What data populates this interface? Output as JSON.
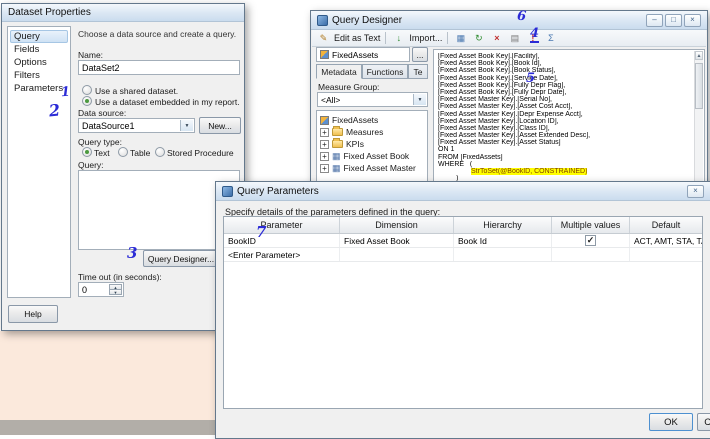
{
  "colors": {
    "annotation_ink": "#2b2bd6",
    "highlight": "#ffff00",
    "titlebar_accent": "#cadcee",
    "surface_peach": "#fbe9dc"
  },
  "annotations": {
    "n1": "1",
    "n2": "2",
    "n3": "3",
    "n4": "4",
    "n5": "5",
    "n6": "6",
    "n7": "7"
  },
  "icons": {
    "close": "×",
    "minimize": "–",
    "maximize": "□",
    "dropdown": "▼",
    "spin_up": "▲",
    "spin_down": "▼",
    "pencil": "✎",
    "import_arrow": "↓",
    "design_grid": "▦",
    "refresh": "↻",
    "delete": "×",
    "empty_cells": "▤",
    "exclaim": "!",
    "sigma": "Σ",
    "plus": "+",
    "dimension": "▦",
    "scroll_up": "▲"
  },
  "dataset_properties": {
    "title": "Dataset Properties",
    "nav": [
      "Query",
      "Fields",
      "Options",
      "Filters",
      "Parameters"
    ],
    "heading": "Choose a data source and create a query.",
    "name_label": "Name:",
    "name_value": "DataSet2",
    "shared_dataset_option": "Use a shared dataset.",
    "embedded_dataset_option": "Use a dataset embedded in my report.",
    "data_source_label": "Data source:",
    "data_source_value": "DataSource1",
    "new_button": "New...",
    "query_type_label": "Query type:",
    "query_type_options": [
      "Text",
      "Table",
      "Stored Procedure"
    ],
    "query_label": "Query:",
    "query_designer_button": "Query Designer...",
    "timeout_label": "Time out (in seconds):",
    "timeout_value": "0",
    "help_button": "Help"
  },
  "query_designer": {
    "title": "Query Designer",
    "toolbar": {
      "edit_as_text": "Edit as Text",
      "import": "Import..."
    },
    "cube_name": "FixedAssets",
    "cube_browse_button": "...",
    "tabs": [
      "Metadata",
      "Functions",
      "Te"
    ],
    "measure_group_label": "Measure Group:",
    "measure_group_value": "<All>",
    "tree": [
      "FixedAssets",
      "Measures",
      "KPIs",
      "Fixed Asset Book",
      "Fixed Asset Master"
    ],
    "query_lines": [
      "[Fixed Asset Book Key].[Facility],",
      "[Fixed Asset Book Key].[Book Id],",
      "[Fixed Asset Book Key].[Book Status],",
      "[Fixed Asset Book Key].[Service Date],",
      "[Fixed Asset Book Key].[Fully Depr Flag],",
      "[Fixed Asset Book Key].[Fully Depr Date],",
      "[Fixed Asset Master Key].[Serial No],",
      "[Fixed Asset Master Key].[Asset Cost Acct],",
      "[Fixed Asset Master Key].[Depr Expense Acct],",
      "[Fixed Asset Master Key].[Location ID],",
      "[Fixed Asset Master Key].[Class ID],",
      "[Fixed Asset Master Key].[Asset Extended Desc],",
      "[Fixed Asset Master Key].[Asset Status]",
      "ON 1",
      "FROM [FixedAssets]",
      "WHERE   ("
    ],
    "highlighted_text": "StrToSet(@BookID, CONSTRAINED)",
    "closing_paren": ")"
  },
  "query_parameters": {
    "title": "Query Parameters",
    "instruction": "Specify details of the parameters defined in the query:",
    "columns": [
      "Parameter",
      "Dimension",
      "Hierarchy",
      "Multiple values",
      "Default"
    ],
    "rows": [
      {
        "parameter": "BookID",
        "dimension": "Fixed Asset Book",
        "hierarchy": "Book Id",
        "multiple_mark": "✓",
        "default": "ACT, AMT, STA, TAX"
      },
      {
        "parameter": "<Enter Parameter>",
        "dimension": "",
        "hierarchy": "",
        "multiple_mark": "",
        "default": ""
      }
    ],
    "ok_button": "OK",
    "cancel_button": "Cancel"
  }
}
